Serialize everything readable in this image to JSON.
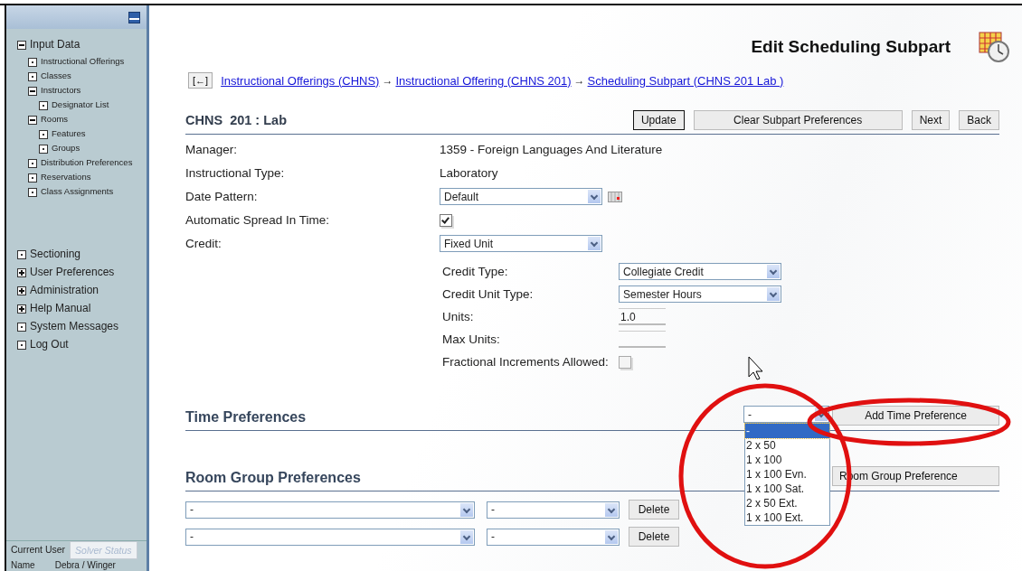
{
  "sidebar": {
    "tree": [
      {
        "label": "Input Data",
        "kind": "node",
        "expanded": true,
        "children": [
          {
            "label": "Instructional Offerings",
            "kind": "leaf"
          },
          {
            "label": "Classes",
            "kind": "leaf"
          },
          {
            "label": "Instructors",
            "kind": "node",
            "expanded": true,
            "children": [
              {
                "label": "Designator List",
                "kind": "leaf"
              }
            ]
          },
          {
            "label": "Rooms",
            "kind": "node",
            "expanded": true,
            "children": [
              {
                "label": "Features",
                "kind": "leaf"
              },
              {
                "label": "Groups",
                "kind": "leaf"
              }
            ]
          },
          {
            "label": "Distribution Preferences",
            "kind": "leaf"
          },
          {
            "label": "Reservations",
            "kind": "leaf"
          },
          {
            "label": "Class Assignments",
            "kind": "leaf"
          }
        ]
      }
    ],
    "menu": [
      {
        "label": "Sectioning",
        "kind": "leaf"
      },
      {
        "label": "User Preferences",
        "kind": "node",
        "expanded": false
      },
      {
        "label": "Administration",
        "kind": "node",
        "expanded": false
      },
      {
        "label": "Help Manual",
        "kind": "node",
        "expanded": false
      },
      {
        "label": "System Messages",
        "kind": "leaf"
      },
      {
        "label": "Log Out",
        "kind": "leaf"
      }
    ],
    "tabs": [
      {
        "label": "Current User",
        "selected": true
      },
      {
        "label": "Solver Status",
        "selected": false
      }
    ],
    "user_row": {
      "label": "Name",
      "value": "Debra / Winger"
    }
  },
  "page_title": "Edit Scheduling Subpart",
  "breadcrumb": {
    "back": "[←]",
    "links": [
      "Instructional Offerings (CHNS)",
      "Instructional Offering (CHNS 201)",
      "Scheduling Subpart (CHNS 201 Lab )"
    ],
    "separator": "→"
  },
  "header": {
    "title": "CHNS  201 : Lab",
    "buttons": [
      {
        "label": "Update",
        "focused": true
      },
      {
        "label": "Clear Subpart Preferences",
        "focused": false
      },
      {
        "label": "Next",
        "focused": false
      },
      {
        "label": "Back",
        "focused": false
      }
    ]
  },
  "fields": [
    {
      "label": "Manager:",
      "kind": "text",
      "value": "1359 - Foreign Languages And Literature"
    },
    {
      "label": "Instructional Type:",
      "kind": "text",
      "value": "Laboratory"
    },
    {
      "label": "Date Pattern:",
      "kind": "date-select",
      "value": "Default"
    },
    {
      "label": "Automatic Spread In Time:",
      "kind": "checkbox",
      "checked": true
    },
    {
      "label": "Credit:",
      "kind": "select",
      "value": "Fixed Unit"
    }
  ],
  "credit_fields": [
    {
      "label": "Credit Type:",
      "kind": "select",
      "value": "Collegiate Credit"
    },
    {
      "label": "Credit Unit Type:",
      "kind": "select",
      "value": "Semester Hours"
    },
    {
      "label": "Units:",
      "kind": "input",
      "value": "1.0"
    },
    {
      "label": "Max Units:",
      "kind": "input"
    },
    {
      "label": "Fractional Increments Allowed:",
      "kind": "checkbox",
      "checked": false
    }
  ],
  "time_preferences": {
    "title": "Time Preferences",
    "select": {
      "value": "-",
      "open": true,
      "options": [
        {
          "label": "-",
          "selected": true
        },
        {
          "label": "2 x 50",
          "selected": false
        },
        {
          "label": "1 x 100",
          "selected": false
        },
        {
          "label": "1 x 100 Evn.",
          "selected": false
        },
        {
          "label": "1 x 100 Sat.",
          "selected": false
        },
        {
          "label": "2 x 50 Ext.",
          "selected": false
        },
        {
          "label": "1 x 100 Ext.",
          "selected": false
        }
      ]
    },
    "button": "Add Time Preference"
  },
  "room_group_preferences": {
    "title": "Room Group Preferences",
    "button": "Room Group Preference",
    "rows": [
      {
        "group": "-",
        "preference": "-",
        "button": "Delete"
      },
      {
        "group": "-",
        "preference": "-",
        "button": "Delete"
      }
    ]
  }
}
